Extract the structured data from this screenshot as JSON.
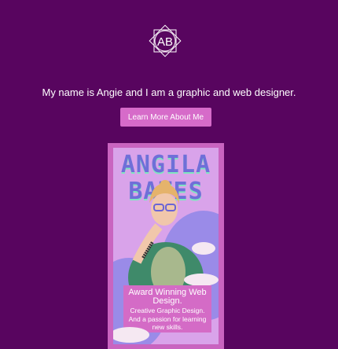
{
  "logo": {
    "initials": "AB"
  },
  "hero": {
    "tagline": "My name is Angie and I am a graphic and web designer.",
    "cta_label": "Learn More About Me"
  },
  "card": {
    "title_line1": "ANGILA",
    "title_line2": "BATES",
    "caption_heading": "Award Winning Web Design.",
    "caption_line1": "Creative Graphic Design.",
    "caption_line2": "And a passion for learning new skills."
  },
  "colors": {
    "background": "#58055f",
    "accent": "#d66bc9"
  }
}
